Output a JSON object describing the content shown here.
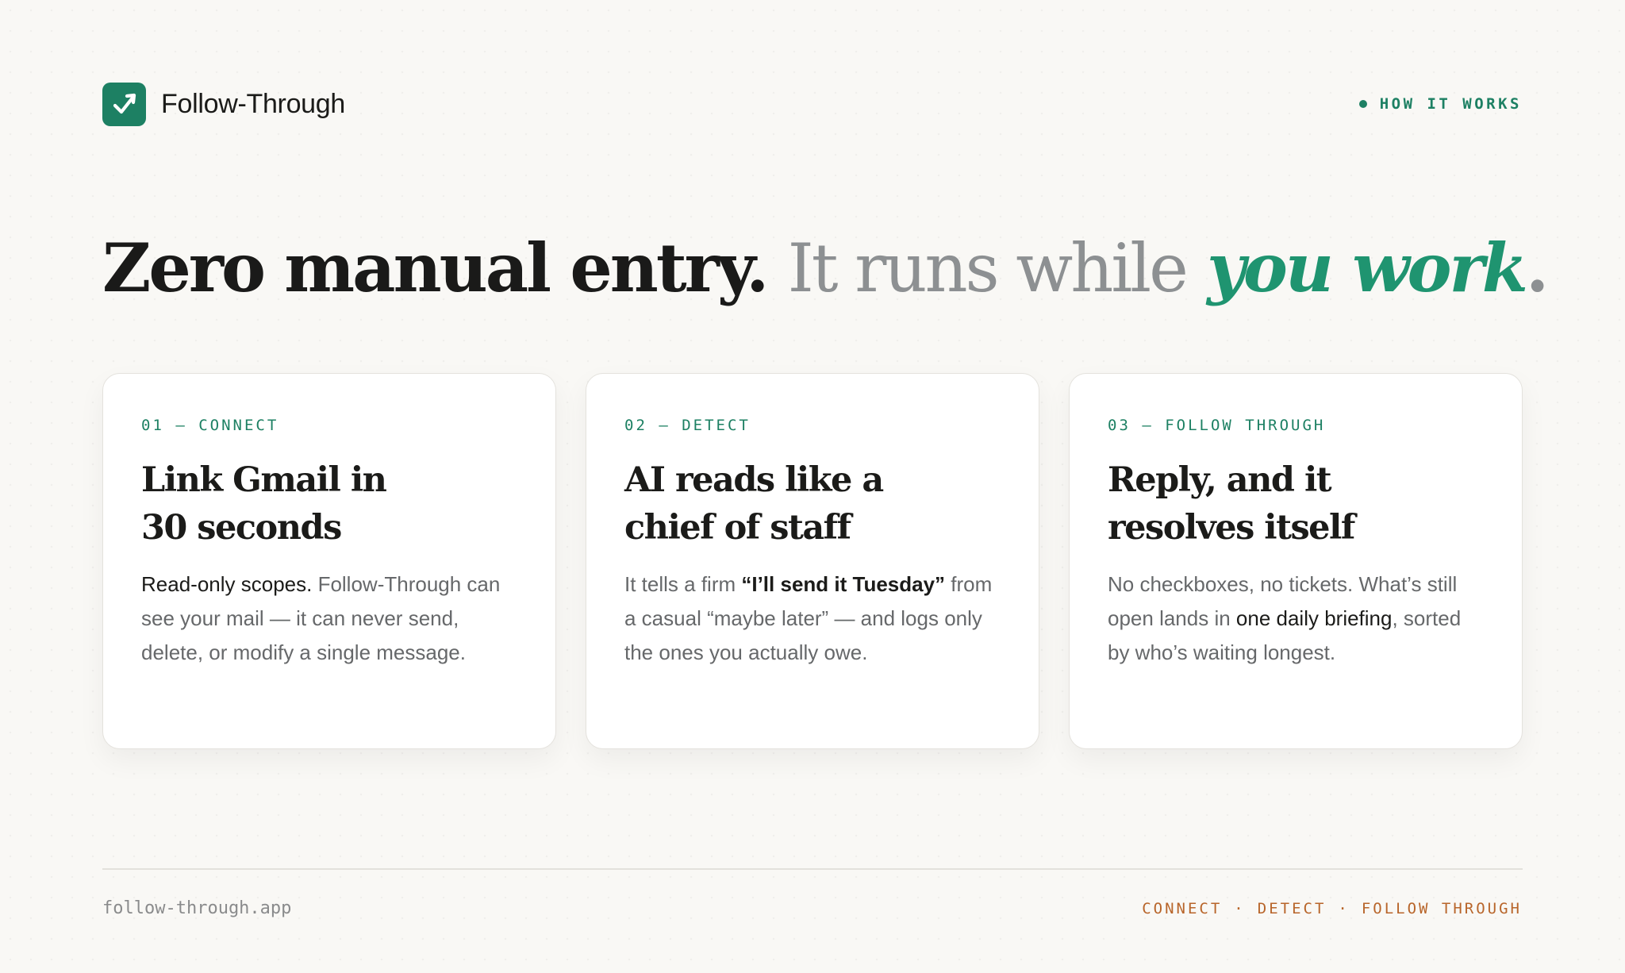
{
  "brand": {
    "name": "Follow-Through",
    "logo_icon": "trend-up-check-icon",
    "accent_color": "#1d8063"
  },
  "section_tag": "HOW IT WORKS",
  "headline": {
    "part1": "Zero manual entry.",
    "part2": "It runs while",
    "part3": "you work",
    "part4": "."
  },
  "cards": [
    {
      "step": "01 — CONNECT",
      "title_line1": "Link Gmail in",
      "title_line2": "30 seconds",
      "body": [
        {
          "text": "Read-only scopes.",
          "style": "em"
        },
        {
          "text": " Follow-Through can see your mail — it can never send, delete, or modify a single message.",
          "style": ""
        }
      ]
    },
    {
      "step": "02 — DETECT",
      "title_line1": "AI reads like a",
      "title_line2": "chief of staff",
      "body": [
        {
          "text": "It tells a firm ",
          "style": ""
        },
        {
          "text": "“I’ll send it Tuesday”",
          "style": "strong"
        },
        {
          "text": " from a casual “maybe later” — and logs only the ones you actually owe.",
          "style": ""
        }
      ]
    },
    {
      "step": "03 — FOLLOW THROUGH",
      "title_line1": "Reply, and it",
      "title_line2": "resolves itself",
      "body": [
        {
          "text": "No checkboxes, no tickets. What’s still open lands in ",
          "style": ""
        },
        {
          "text": "one daily briefing",
          "style": "em"
        },
        {
          "text": ", sorted by who’s waiting longest.",
          "style": ""
        }
      ]
    }
  ],
  "footer": {
    "url": "follow-through.app",
    "steps": [
      "CONNECT",
      "DETECT",
      "FOLLOW THROUGH"
    ],
    "separator": "·",
    "color": "#b8652a"
  }
}
